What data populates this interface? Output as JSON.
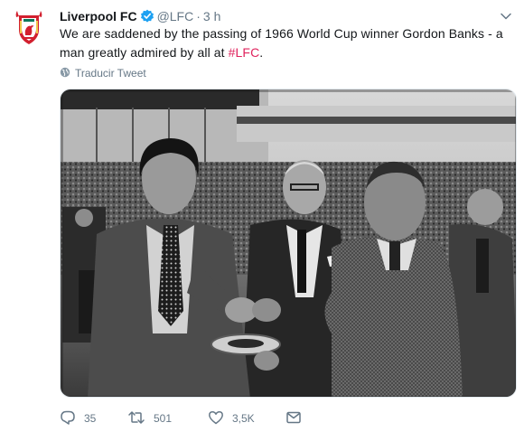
{
  "tweet": {
    "display_name": "Liverpool FC",
    "handle": "@LFC",
    "separator": "·",
    "time": "3 h",
    "text_main": "We are saddened by the passing of 1966 World Cup winner Gordon Banks - a man greatly admired by all at ",
    "hashtag": "#LFC",
    "text_end": ".",
    "translate_label": "Traducir Tweet",
    "hashtag_color": "#e0245e",
    "verified_color": "#1da1f2",
    "avatar_icon": "liverpool-crest-icon",
    "photo_style": "black-and-white"
  },
  "actions": {
    "reply_count": "35",
    "retweet_count": "501",
    "like_count": "3,5K"
  }
}
